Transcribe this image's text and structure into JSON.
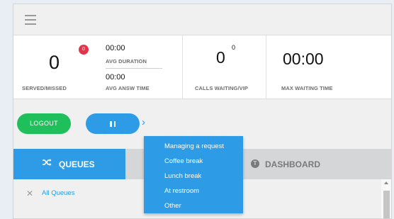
{
  "icons": {
    "menu": "hamburger-menu-icon",
    "pause": "pause-icon",
    "chevron": "chevron-right-icon",
    "queues": "shuffle-icon",
    "dashboard": "circle-t-icon",
    "clear": "close-icon"
  },
  "stats": {
    "served": "0",
    "missed_badge": "0",
    "served_label": "SERVED/MISSED",
    "avg_duration": "00:00",
    "avg_duration_label": "AVG DURATION",
    "avg_answer": "00:00",
    "avg_answer_label": "AVG ANSW TIME",
    "calls_waiting": "0",
    "vip": "0",
    "calls_label": "CALLS WAITING/VIP",
    "max_wait": "00:00",
    "max_wait_label": "MAX WAITING TIME"
  },
  "actions": {
    "logout_label": "LOGOUT"
  },
  "pause_menu": {
    "items": [
      "Managing a request",
      "Coffee break",
      "Lunch break",
      "At restroom",
      "Other"
    ]
  },
  "tabs": {
    "queues_label": "QUEUES",
    "dashboard_label": "DASHBOARD",
    "dashboard_glyph": "T"
  },
  "queues": {
    "all_label": "All Queues",
    "clear_glyph": "✕"
  },
  "colors": {
    "green": "#1fbf5b",
    "blue": "#2d9be5",
    "red_badge": "#e5344a"
  }
}
